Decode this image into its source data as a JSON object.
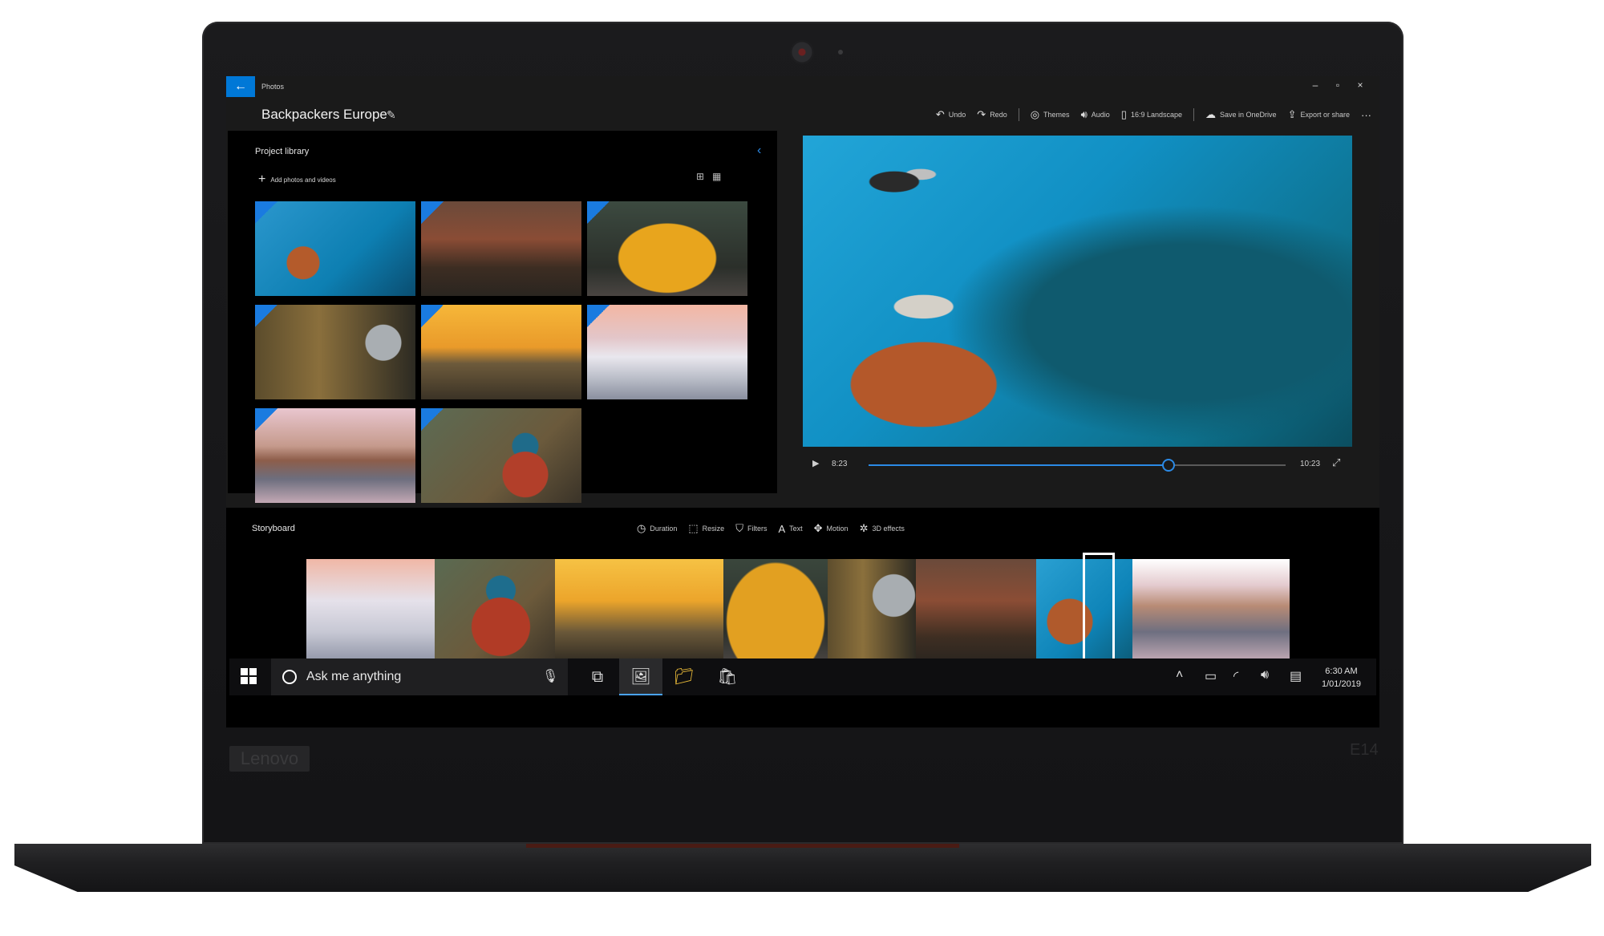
{
  "device": {
    "brand": "Lenovo",
    "model": "E14"
  },
  "window": {
    "app_name": "Photos",
    "back_icon": "arrow-left-icon",
    "controls": [
      "–",
      "▫",
      "×"
    ],
    "project_title": "Backpackers Europe",
    "accent_color": "#0078d7"
  },
  "toolbar": {
    "undo": "Undo",
    "redo": "Redo",
    "themes": "Themes",
    "audio": "Audio",
    "aspect": "16:9 Landscape",
    "save": "Save in OneDrive",
    "export": "Export or share",
    "more": "···"
  },
  "library": {
    "title": "Project library",
    "add_label": "Add photos and videos",
    "items": [
      "bird",
      "house",
      "van",
      "man",
      "sunset",
      "santorini",
      "town",
      "hiker"
    ]
  },
  "player": {
    "current_time": "8:23",
    "total_time": "10:23",
    "progress": 0.72
  },
  "storyboard": {
    "title": "Storyboard",
    "tools": [
      "Duration",
      "Resize",
      "Filters",
      "Text",
      "Motion",
      "3D effects"
    ],
    "clips": [
      "santorini",
      "hiker",
      "sunset",
      "van",
      "man",
      "house",
      "bird",
      "town"
    ]
  },
  "taskbar": {
    "search_placeholder": "Ask me anything",
    "time": "6:30 AM",
    "date": "1/01/2019"
  }
}
